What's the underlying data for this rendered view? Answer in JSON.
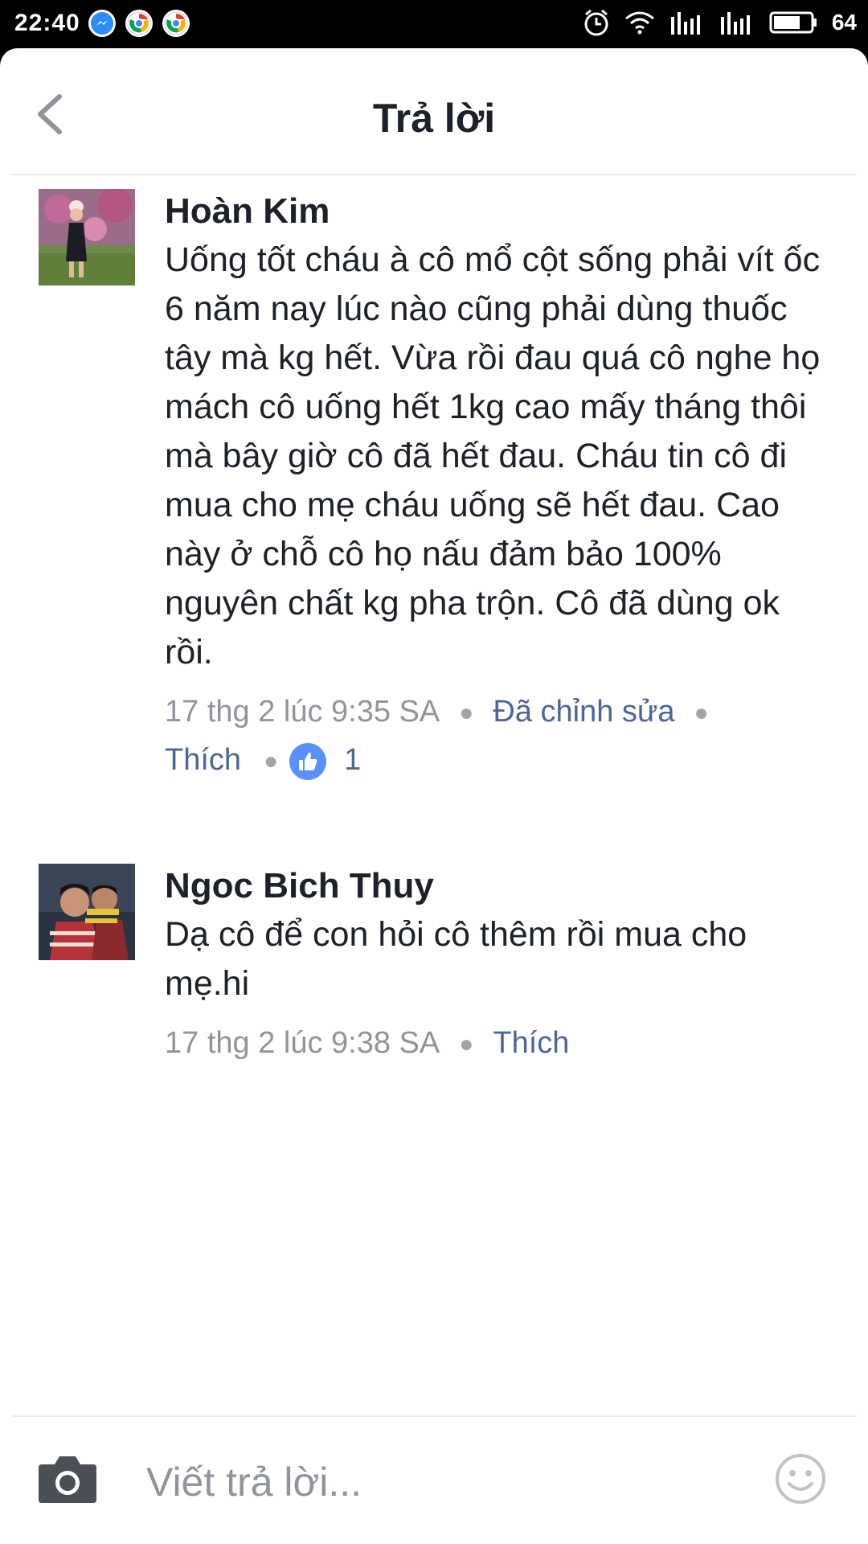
{
  "status_bar": {
    "time": "22:40",
    "battery_level": "64",
    "left_icons": [
      "messenger-icon",
      "chrome-icon",
      "chrome-icon"
    ],
    "right_icons": [
      "alarm-icon",
      "wifi-icon",
      "signal-icon",
      "signal-icon",
      "battery-icon"
    ]
  },
  "header": {
    "title": "Trả lời",
    "back_icon": "chevron-left-icon"
  },
  "comments": [
    {
      "author": "Hoàn Kim",
      "text": "Uống tốt cháu à cô mổ cột sống phải vít ốc 6 năm nay lúc nào cũng phải dùng thuốc tây mà kg hết. Vừa rồi đau quá cô nghe họ mách cô uống hết 1kg cao mấy tháng thôi mà bây giờ cô đã hết đau. Cháu tin cô đi mua cho mẹ cháu uống sẽ hết đau. Cao này ở chỗ cô họ nấu đảm bảo 100% nguyên chất kg pha trộn. Cô đã dùng ok rồi.",
      "timestamp": "17 thg 2 lúc 9:35 SA",
      "edited_label": "Đã chỉnh sửa",
      "like_label": "Thích",
      "like_count": "1"
    },
    {
      "author": "Ngoc Bich Thuy",
      "text": "Dạ cô để con hỏi cô thêm rồi mua cho mẹ.hi",
      "timestamp": "17 thg 2 lúc 9:38 SA",
      "like_label": "Thích"
    }
  ],
  "composer": {
    "placeholder": "Viết trả lời...",
    "camera_icon": "camera-icon",
    "emoji_icon": "smiley-icon"
  },
  "colors": {
    "text": "#1d2129",
    "meta": "#90949c",
    "link": "#4b6799",
    "like_blue": "#5890ff"
  }
}
